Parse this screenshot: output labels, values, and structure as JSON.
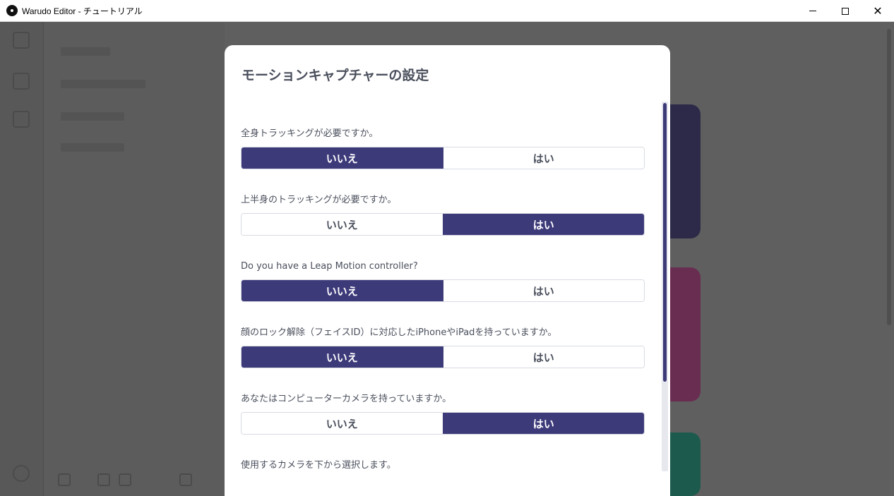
{
  "window": {
    "title": "Warudo Editor - チュートリアル",
    "icon": "warudo-app-icon"
  },
  "modal": {
    "title": "モーションキャプチャーの設定",
    "questions": [
      {
        "label": "全身トラッキングが必要ですか。",
        "no": "いいえ",
        "yes": "はい",
        "selected": "no"
      },
      {
        "label": "上半身のトラッキングが必要ですか。",
        "no": "いいえ",
        "yes": "はい",
        "selected": "yes"
      },
      {
        "label": "Do you have a Leap Motion controller?",
        "no": "いいえ",
        "yes": "はい",
        "selected": "no"
      },
      {
        "label": "顔のロック解除（フェイスID）に対応したiPhoneやiPadを持っていますか。",
        "no": "いいえ",
        "yes": "はい",
        "selected": "no"
      },
      {
        "label": "あなたはコンピューターカメラを持っていますか。",
        "no": "いいえ",
        "yes": "はい",
        "selected": "yes"
      }
    ],
    "footer_label": "使用するカメラを下から選択します。"
  },
  "colors": {
    "accent": "#3d3a7a",
    "overlay": "#5f5f5f"
  }
}
